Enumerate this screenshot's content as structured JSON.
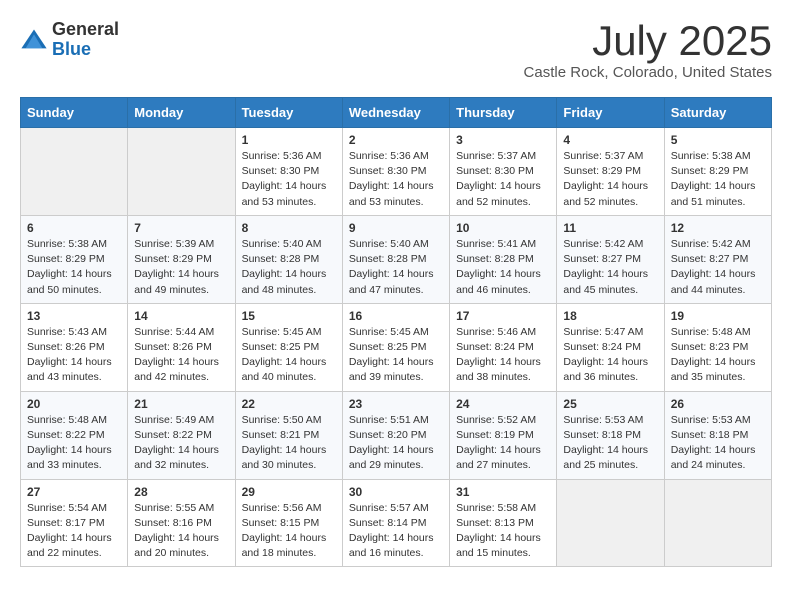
{
  "header": {
    "logo_general": "General",
    "logo_blue": "Blue",
    "month_title": "July 2025",
    "location": "Castle Rock, Colorado, United States"
  },
  "weekdays": [
    "Sunday",
    "Monday",
    "Tuesday",
    "Wednesday",
    "Thursday",
    "Friday",
    "Saturday"
  ],
  "weeks": [
    [
      {
        "day": "",
        "sunrise": "",
        "sunset": "",
        "daylight": ""
      },
      {
        "day": "",
        "sunrise": "",
        "sunset": "",
        "daylight": ""
      },
      {
        "day": "1",
        "sunrise": "Sunrise: 5:36 AM",
        "sunset": "Sunset: 8:30 PM",
        "daylight": "Daylight: 14 hours and 53 minutes."
      },
      {
        "day": "2",
        "sunrise": "Sunrise: 5:36 AM",
        "sunset": "Sunset: 8:30 PM",
        "daylight": "Daylight: 14 hours and 53 minutes."
      },
      {
        "day": "3",
        "sunrise": "Sunrise: 5:37 AM",
        "sunset": "Sunset: 8:30 PM",
        "daylight": "Daylight: 14 hours and 52 minutes."
      },
      {
        "day": "4",
        "sunrise": "Sunrise: 5:37 AM",
        "sunset": "Sunset: 8:29 PM",
        "daylight": "Daylight: 14 hours and 52 minutes."
      },
      {
        "day": "5",
        "sunrise": "Sunrise: 5:38 AM",
        "sunset": "Sunset: 8:29 PM",
        "daylight": "Daylight: 14 hours and 51 minutes."
      }
    ],
    [
      {
        "day": "6",
        "sunrise": "Sunrise: 5:38 AM",
        "sunset": "Sunset: 8:29 PM",
        "daylight": "Daylight: 14 hours and 50 minutes."
      },
      {
        "day": "7",
        "sunrise": "Sunrise: 5:39 AM",
        "sunset": "Sunset: 8:29 PM",
        "daylight": "Daylight: 14 hours and 49 minutes."
      },
      {
        "day": "8",
        "sunrise": "Sunrise: 5:40 AM",
        "sunset": "Sunset: 8:28 PM",
        "daylight": "Daylight: 14 hours and 48 minutes."
      },
      {
        "day": "9",
        "sunrise": "Sunrise: 5:40 AM",
        "sunset": "Sunset: 8:28 PM",
        "daylight": "Daylight: 14 hours and 47 minutes."
      },
      {
        "day": "10",
        "sunrise": "Sunrise: 5:41 AM",
        "sunset": "Sunset: 8:28 PM",
        "daylight": "Daylight: 14 hours and 46 minutes."
      },
      {
        "day": "11",
        "sunrise": "Sunrise: 5:42 AM",
        "sunset": "Sunset: 8:27 PM",
        "daylight": "Daylight: 14 hours and 45 minutes."
      },
      {
        "day": "12",
        "sunrise": "Sunrise: 5:42 AM",
        "sunset": "Sunset: 8:27 PM",
        "daylight": "Daylight: 14 hours and 44 minutes."
      }
    ],
    [
      {
        "day": "13",
        "sunrise": "Sunrise: 5:43 AM",
        "sunset": "Sunset: 8:26 PM",
        "daylight": "Daylight: 14 hours and 43 minutes."
      },
      {
        "day": "14",
        "sunrise": "Sunrise: 5:44 AM",
        "sunset": "Sunset: 8:26 PM",
        "daylight": "Daylight: 14 hours and 42 minutes."
      },
      {
        "day": "15",
        "sunrise": "Sunrise: 5:45 AM",
        "sunset": "Sunset: 8:25 PM",
        "daylight": "Daylight: 14 hours and 40 minutes."
      },
      {
        "day": "16",
        "sunrise": "Sunrise: 5:45 AM",
        "sunset": "Sunset: 8:25 PM",
        "daylight": "Daylight: 14 hours and 39 minutes."
      },
      {
        "day": "17",
        "sunrise": "Sunrise: 5:46 AM",
        "sunset": "Sunset: 8:24 PM",
        "daylight": "Daylight: 14 hours and 38 minutes."
      },
      {
        "day": "18",
        "sunrise": "Sunrise: 5:47 AM",
        "sunset": "Sunset: 8:24 PM",
        "daylight": "Daylight: 14 hours and 36 minutes."
      },
      {
        "day": "19",
        "sunrise": "Sunrise: 5:48 AM",
        "sunset": "Sunset: 8:23 PM",
        "daylight": "Daylight: 14 hours and 35 minutes."
      }
    ],
    [
      {
        "day": "20",
        "sunrise": "Sunrise: 5:48 AM",
        "sunset": "Sunset: 8:22 PM",
        "daylight": "Daylight: 14 hours and 33 minutes."
      },
      {
        "day": "21",
        "sunrise": "Sunrise: 5:49 AM",
        "sunset": "Sunset: 8:22 PM",
        "daylight": "Daylight: 14 hours and 32 minutes."
      },
      {
        "day": "22",
        "sunrise": "Sunrise: 5:50 AM",
        "sunset": "Sunset: 8:21 PM",
        "daylight": "Daylight: 14 hours and 30 minutes."
      },
      {
        "day": "23",
        "sunrise": "Sunrise: 5:51 AM",
        "sunset": "Sunset: 8:20 PM",
        "daylight": "Daylight: 14 hours and 29 minutes."
      },
      {
        "day": "24",
        "sunrise": "Sunrise: 5:52 AM",
        "sunset": "Sunset: 8:19 PM",
        "daylight": "Daylight: 14 hours and 27 minutes."
      },
      {
        "day": "25",
        "sunrise": "Sunrise: 5:53 AM",
        "sunset": "Sunset: 8:18 PM",
        "daylight": "Daylight: 14 hours and 25 minutes."
      },
      {
        "day": "26",
        "sunrise": "Sunrise: 5:53 AM",
        "sunset": "Sunset: 8:18 PM",
        "daylight": "Daylight: 14 hours and 24 minutes."
      }
    ],
    [
      {
        "day": "27",
        "sunrise": "Sunrise: 5:54 AM",
        "sunset": "Sunset: 8:17 PM",
        "daylight": "Daylight: 14 hours and 22 minutes."
      },
      {
        "day": "28",
        "sunrise": "Sunrise: 5:55 AM",
        "sunset": "Sunset: 8:16 PM",
        "daylight": "Daylight: 14 hours and 20 minutes."
      },
      {
        "day": "29",
        "sunrise": "Sunrise: 5:56 AM",
        "sunset": "Sunset: 8:15 PM",
        "daylight": "Daylight: 14 hours and 18 minutes."
      },
      {
        "day": "30",
        "sunrise": "Sunrise: 5:57 AM",
        "sunset": "Sunset: 8:14 PM",
        "daylight": "Daylight: 14 hours and 16 minutes."
      },
      {
        "day": "31",
        "sunrise": "Sunrise: 5:58 AM",
        "sunset": "Sunset: 8:13 PM",
        "daylight": "Daylight: 14 hours and 15 minutes."
      },
      {
        "day": "",
        "sunrise": "",
        "sunset": "",
        "daylight": ""
      },
      {
        "day": "",
        "sunrise": "",
        "sunset": "",
        "daylight": ""
      }
    ]
  ]
}
